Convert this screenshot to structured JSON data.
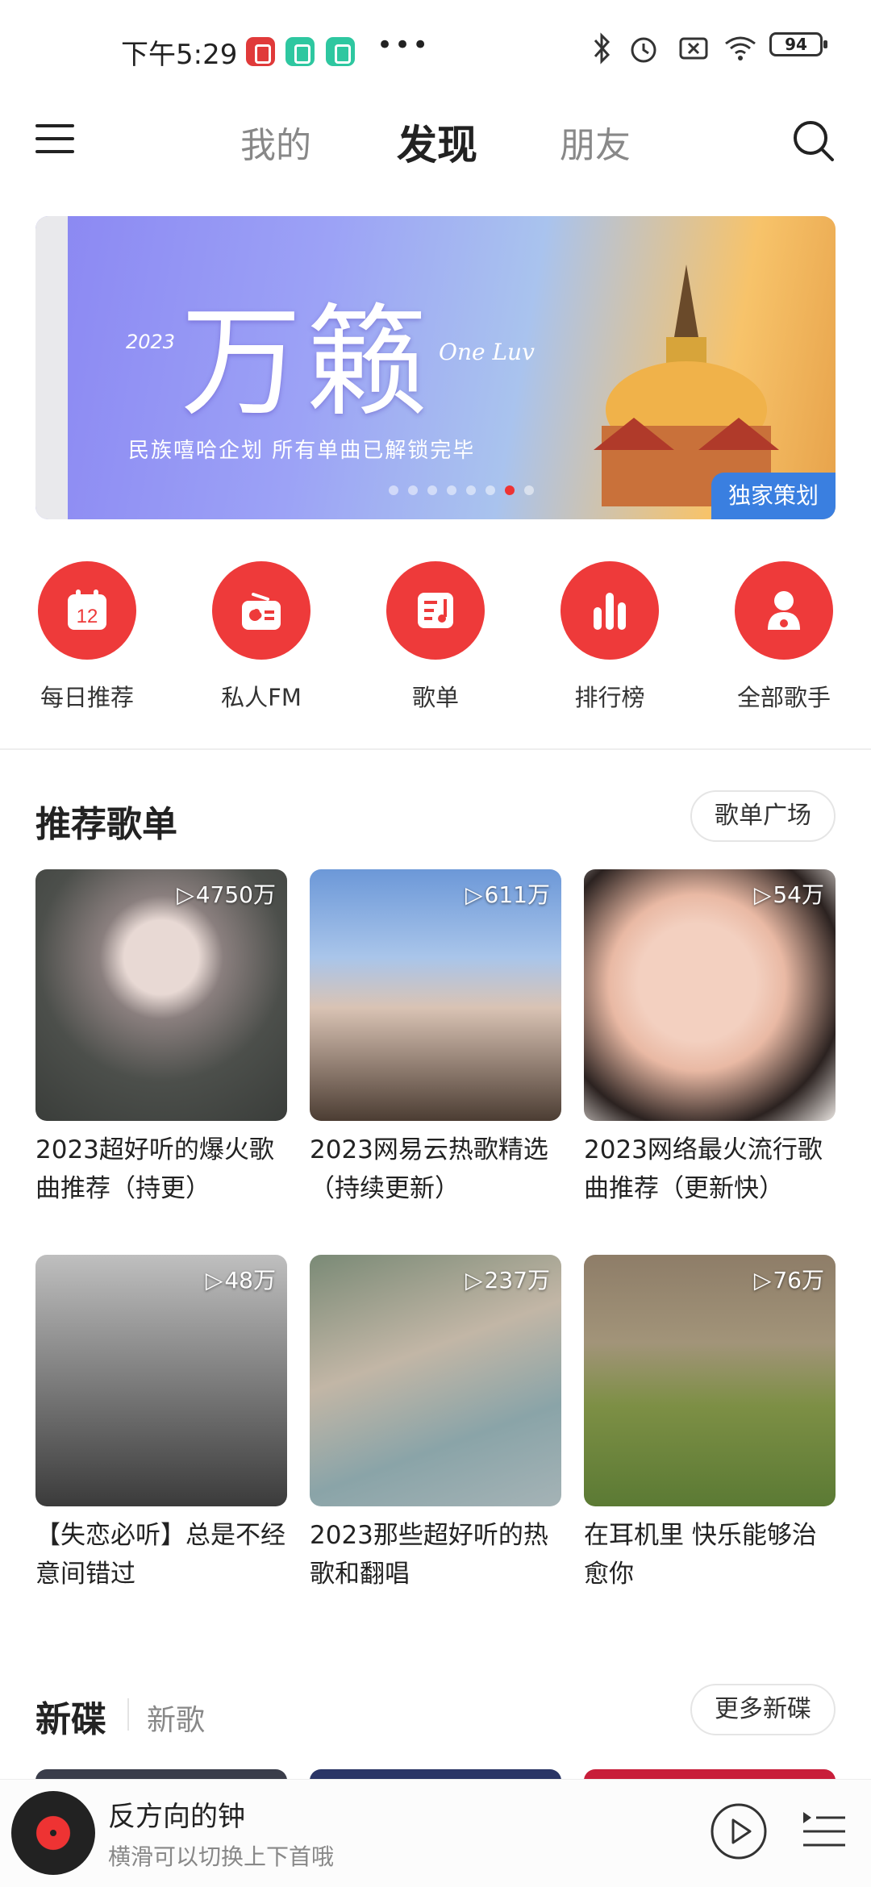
{
  "status_bar": {
    "time": "下午5:29",
    "more": "•••",
    "battery": "94"
  },
  "nav": {
    "tabs": [
      {
        "label": "我的"
      },
      {
        "label": "发现"
      },
      {
        "label": "朋友"
      }
    ],
    "active_tab": "发现"
  },
  "banner": {
    "year": "2023",
    "title": "万籁",
    "subtitle_en": "One Luv",
    "tagline": "民族嘻哈企划 所有单曲已解锁完毕",
    "badge": "独家策划"
  },
  "quick_entries": [
    {
      "label": "每日推荐",
      "icon": "calendar-icon"
    },
    {
      "label": "私人FM",
      "icon": "radio-icon"
    },
    {
      "label": "歌单",
      "icon": "playlist-icon"
    },
    {
      "label": "排行榜",
      "icon": "chart-bars-icon"
    },
    {
      "label": "全部歌手",
      "icon": "singer-icon"
    }
  ],
  "recommended": {
    "title": "推荐歌单",
    "more_button": "歌单广场",
    "playlists": [
      {
        "count": "4750万",
        "title": "2023超好听的爆火歌曲推荐（持更）"
      },
      {
        "count": "611万",
        "title": "2023网易云热歌精选（持续更新）"
      },
      {
        "count": "54万",
        "title": "2023网络最火流行歌曲推荐（更新快）"
      },
      {
        "count": "48万",
        "title": "【失恋必听】总是不经意间错过"
      },
      {
        "count": "237万",
        "title": "2023那些超好听的热歌和翻唱"
      },
      {
        "count": "76万",
        "title": "在耳机里 快乐能够治愈你"
      }
    ]
  },
  "new_disc": {
    "title": "新碟",
    "subtitle": "新歌",
    "more_button": "更多新碟"
  },
  "player": {
    "song": "反方向的钟",
    "hint": "横滑可以切换上下首哦"
  },
  "colors": {
    "accent": "#ee3a3a",
    "banner_badge": "#3a7fe0"
  }
}
